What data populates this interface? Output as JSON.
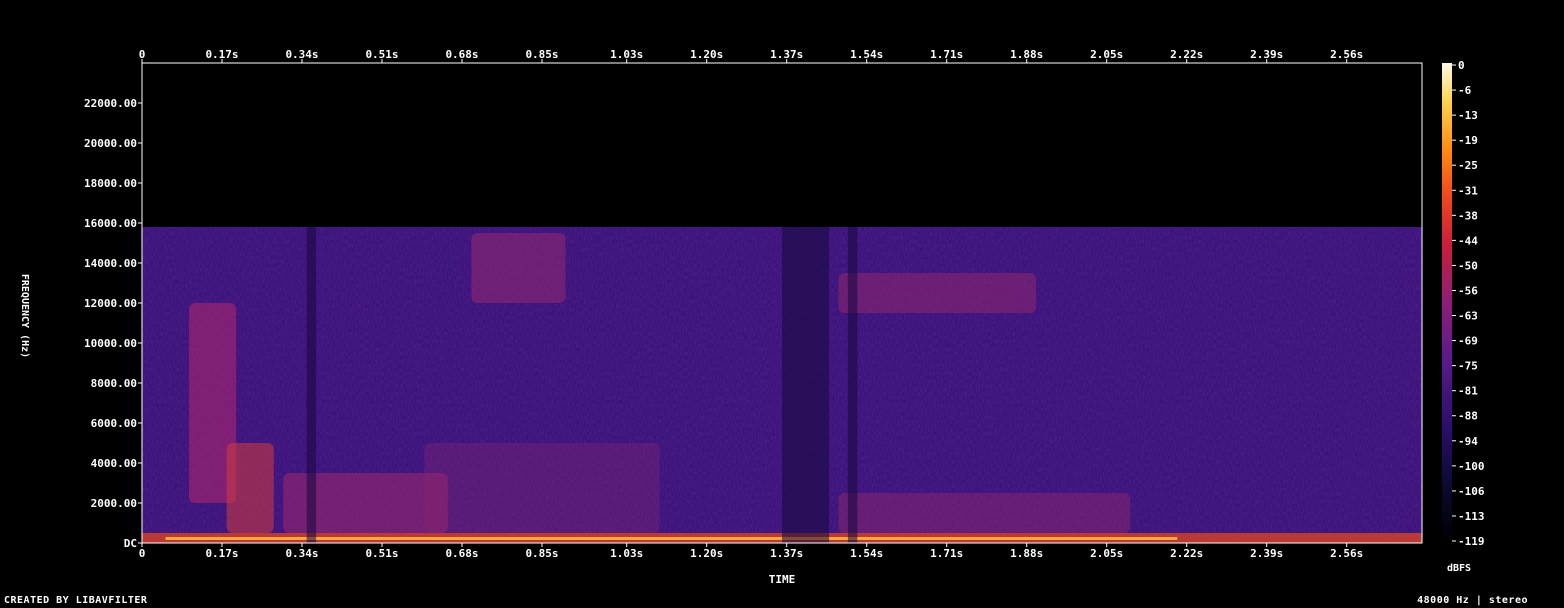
{
  "chart_data": {
    "type": "heatmap",
    "x_ticks": [
      "0",
      "0.17s",
      "0.34s",
      "0.51s",
      "0.68s",
      "0.85s",
      "1.03s",
      "1.20s",
      "1.37s",
      "1.54s",
      "1.71s",
      "1.88s",
      "2.05s",
      "2.22s",
      "2.39s",
      "2.56s"
    ],
    "x_tick_values": [
      0,
      0.17,
      0.34,
      0.51,
      0.68,
      0.85,
      1.03,
      1.2,
      1.37,
      1.54,
      1.71,
      1.88,
      2.05,
      2.22,
      2.39,
      2.56
    ],
    "xlim": [
      0,
      2.72
    ],
    "xlabel": "TIME",
    "y_ticks": [
      "DC",
      "2000.00",
      "4000.00",
      "6000.00",
      "8000.00",
      "10000.00",
      "12000.00",
      "14000.00",
      "16000.00",
      "18000.00",
      "20000.00",
      "22000.00"
    ],
    "y_tick_values": [
      0,
      2000,
      4000,
      6000,
      8000,
      10000,
      12000,
      14000,
      16000,
      18000,
      20000,
      22000
    ],
    "ylim": [
      0,
      24000
    ],
    "ylabel": "FREQUENCY (Hz)",
    "colorbar": {
      "label": "dBFS",
      "ticks": [
        "0",
        "-6",
        "-13",
        "-19",
        "-25",
        "-31",
        "-38",
        "-44",
        "-50",
        "-56",
        "-63",
        "-69",
        "-75",
        "-81",
        "-88",
        "-94",
        "-100",
        "-106",
        "-113",
        "-119"
      ],
      "range": [
        -120,
        0
      ],
      "colors": [
        "#000000",
        "#0a0a32",
        "#2d0f6e",
        "#5a1a8c",
        "#8c1e78",
        "#c81e3c",
        "#f0461e",
        "#ff8c14",
        "#ffd250",
        "#fffae6"
      ]
    },
    "content_cutoff_hz": 15800,
    "description_regions": {
      "energy_band_low": [
        0,
        500
      ],
      "time_span": [
        0,
        2.72
      ]
    }
  },
  "footer": {
    "left": "CREATED BY LIBAVFILTER",
    "right": "48000 Hz | stereo"
  }
}
